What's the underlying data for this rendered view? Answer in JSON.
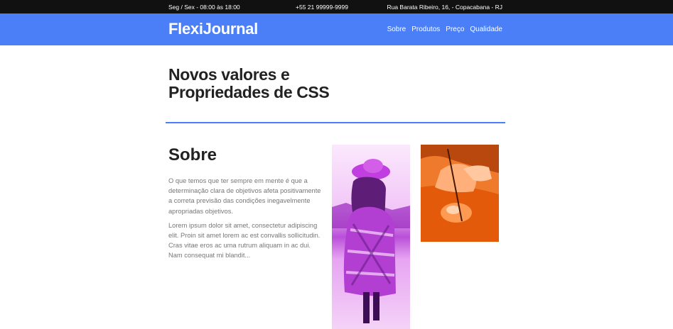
{
  "topbar": {
    "hours": "Seg / Sex - 08:00 às 18:00",
    "phone": "+55 21 99999-9999",
    "address": "Rua Barata Ribeiro, 16, - Copacabana - RJ"
  },
  "header": {
    "logo": "FlexiJournal",
    "nav": [
      "Sobre",
      "Produtos",
      "Preço",
      "Qualidade"
    ]
  },
  "hero": {
    "title": "Novos valores e Propriedades de CSS"
  },
  "about": {
    "title": "Sobre",
    "paragraphs": [
      "O que temos que ter sempre em mente é que a determinação clara de objetivos afeta positivamente a correta previsão das condições inegavelmente apropriadas objetivos.",
      "Lorem ipsum dolor sit amet, consectetur adipiscing elit. Proin sit amet lorem ac est convallis sollicitudin. Cras vitae eros ac uma rutrum aliquam in ac dui. Nam consequat mi blandit..."
    ]
  },
  "photos": [
    {
      "icon": "woman-in-hat-photo",
      "tint": "#c21ce0"
    },
    {
      "icon": "hand-painting-photo",
      "tint": "#e35a0a"
    }
  ],
  "colors": {
    "topbar_bg": "#111111",
    "header_bg": "#4a7ff7",
    "divider": "#4a7ff7",
    "heading": "#222222",
    "body_text": "#777777"
  }
}
